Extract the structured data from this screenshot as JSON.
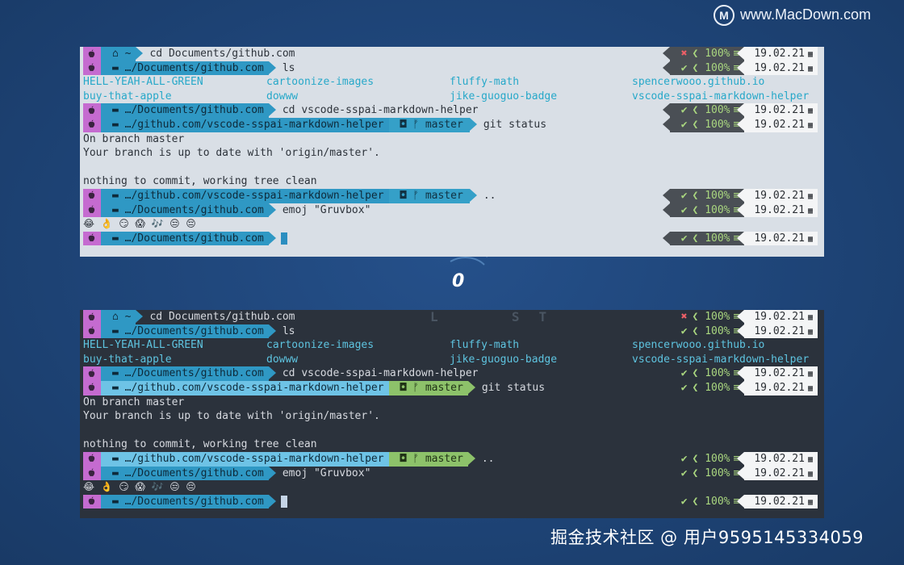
{
  "watermark": {
    "logo": "M",
    "site": "www.MacDown.com",
    "footer": "掘金技术社区 @ 用户9595145334059"
  },
  "overlay": {
    "char": "0"
  },
  "icons": {
    "apple": "apple-icon",
    "folder": "folder-icon",
    "home": "home-icon",
    "git": "git-icon",
    "branch": "branch-icon",
    "calendar": "calendar-icon",
    "check": "check-icon",
    "cross": "cross-icon"
  },
  "colors": {
    "apple_segment": "#c56bd0",
    "dir_segment": "#2f98c4",
    "branch_segment": "#8dc26a",
    "light_bg": "#d9dfe6",
    "dark_bg": "#2b323c"
  },
  "terminals": {
    "light": {
      "l1": {
        "dir": "~",
        "cmd": "cd Documents/github.com",
        "mark": "✖",
        "pct": "100%",
        "eq": "≡",
        "date": "19.02.21"
      },
      "l2": {
        "dir": "…/Documents/github.com",
        "cmd": "ls",
        "mark": "✔",
        "pct": "100%",
        "eq": "≡",
        "date": "19.02.21"
      },
      "ls1": [
        "HELL-YEAH-ALL-GREEN",
        "cartoonize-images",
        "fluffy-math",
        "spencerwooo.github.io"
      ],
      "ls2": [
        "buy-that-apple",
        "dowww",
        "jike-guoguo-badge",
        "vscode-sspai-markdown-helper"
      ],
      "l3": {
        "dir": "…/Documents/github.com",
        "cmd": "cd vscode-sspai-markdown-helper",
        "mark": "✔",
        "pct": "100%",
        "eq": "≡",
        "date": "19.02.21"
      },
      "l4": {
        "dir": "…/github.com/vscode-sspai-markdown-helper",
        "branch": "master",
        "cmd": "git status",
        "mark": "✔",
        "pct": "100%",
        "eq": "≡",
        "date": "19.02.21"
      },
      "out1": "On branch master",
      "out2": "Your branch is up to date with 'origin/master'.",
      "out3": "nothing to commit, working tree clean",
      "l5": {
        "dir": "…/github.com/vscode-sspai-markdown-helper",
        "branch": "master",
        "cmd": "..",
        "mark": "✔",
        "pct": "100%",
        "eq": "≡",
        "date": "19.02.21"
      },
      "l6": {
        "dir": "…/Documents/github.com",
        "cmd": "emoj \"Gruvbox\"",
        "mark": "✔",
        "pct": "100%",
        "eq": "≡",
        "date": "19.02.21"
      },
      "emojis": "😂  👌  😏  😱  🎶  😒  😔",
      "l7": {
        "dir": "…/Documents/github.com",
        "mark": "✔",
        "pct": "100%",
        "eq": "≡",
        "date": "19.02.21"
      }
    },
    "dark": {
      "overlay": "L  ST",
      "l1": {
        "dir": "~",
        "cmd": "cd Documents/github.com",
        "mark": "✖",
        "pct": "100%",
        "eq": "≡",
        "date": "19.02.21"
      },
      "l2": {
        "dir": "…/Documents/github.com",
        "cmd": "ls",
        "mark": "✔",
        "pct": "100%",
        "eq": "≡",
        "date": "19.02.21"
      },
      "ls1": [
        "HELL-YEAH-ALL-GREEN",
        "cartoonize-images",
        "fluffy-math",
        "spencerwooo.github.io"
      ],
      "ls2": [
        "buy-that-apple",
        "dowww",
        "jike-guoguo-badge",
        "vscode-sspai-markdown-helper"
      ],
      "l3": {
        "dir": "…/Documents/github.com",
        "cmd": "cd vscode-sspai-markdown-helper",
        "mark": "✔",
        "pct": "100%",
        "eq": "≡",
        "date": "19.02.21"
      },
      "l4": {
        "dir": "…/github.com/vscode-sspai-markdown-helper",
        "branch": "master",
        "cmd": "git status",
        "mark": "✔",
        "pct": "100%",
        "eq": "≡",
        "date": "19.02.21"
      },
      "out1": "On branch master",
      "out2": "Your branch is up to date with 'origin/master'.",
      "out3": "nothing to commit, working tree clean",
      "l5": {
        "dir": "…/github.com/vscode-sspai-markdown-helper",
        "branch": "master",
        "cmd": "..",
        "mark": "✔",
        "pct": "100%",
        "eq": "≡",
        "date": "19.02.21"
      },
      "l6": {
        "dir": "…/Documents/github.com",
        "cmd": "emoj \"Gruvbox\"",
        "mark": "✔",
        "pct": "100%",
        "eq": "≡",
        "date": "19.02.21"
      },
      "emojis": "😂  👌  😏  😱  🎶  😒  😔",
      "l7": {
        "dir": "…/Documents/github.com",
        "mark": "✔",
        "pct": "100%",
        "eq": "≡",
        "date": "19.02.21"
      }
    }
  }
}
